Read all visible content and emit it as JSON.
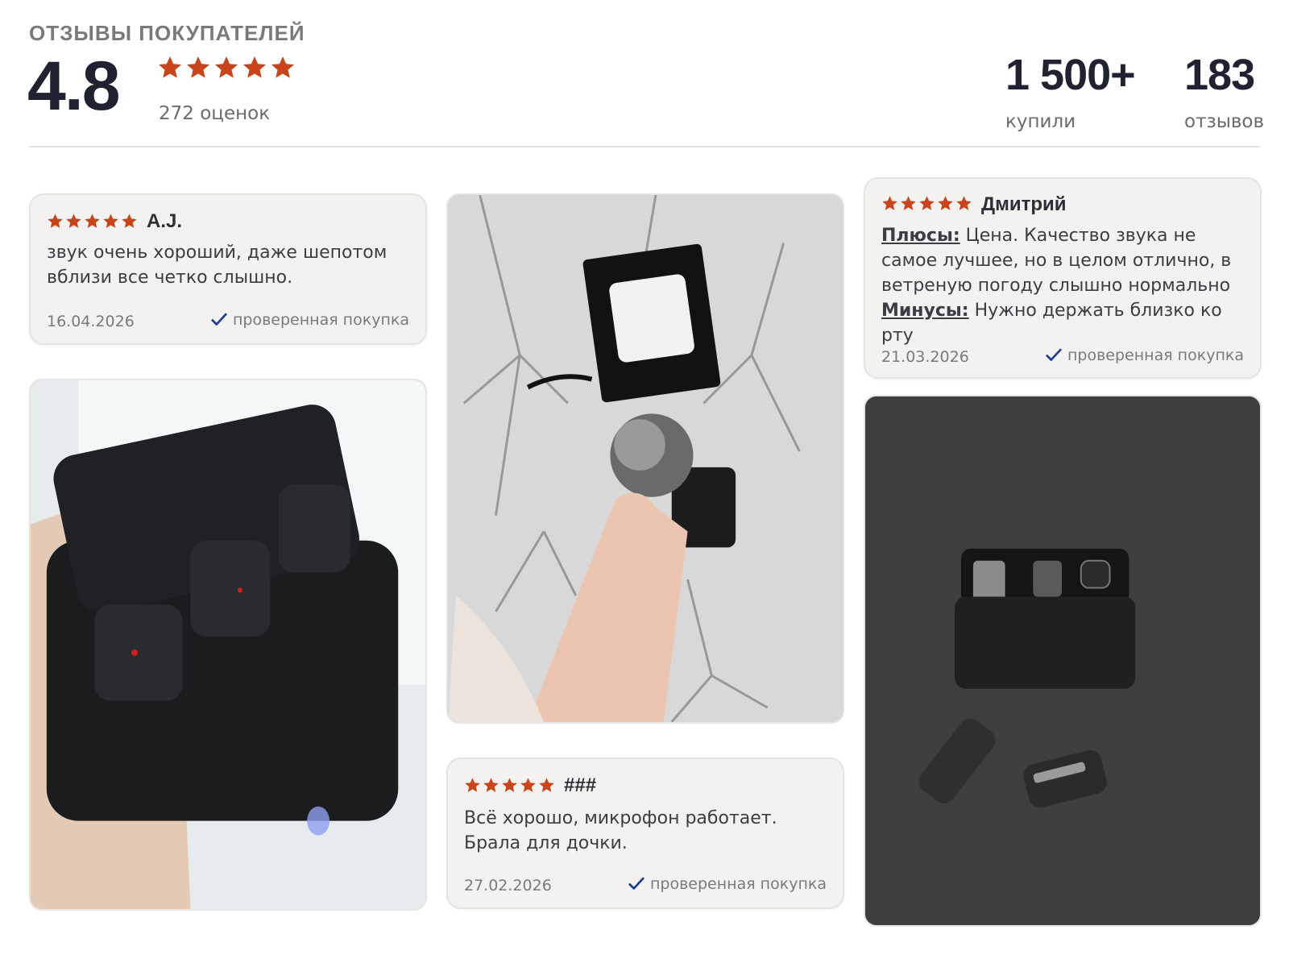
{
  "header": {
    "title": "ОТЗЫВЫ ПОКУПАТЕЛЕЙ",
    "rating": "4.8",
    "ratings_count": "272 оценок",
    "bought_value": "1 500+",
    "bought_label": "купили",
    "reviews_value": "183",
    "reviews_label": "отзывов"
  },
  "colors": {
    "star": "#c8451c",
    "check": "#1d3d8f"
  },
  "reviews": [
    {
      "author": "A.J.",
      "stars": 5,
      "text": "звук очень хороший, даже шепотом вблизи все четко слышно.",
      "date": "16.04.2026",
      "verified": "проверенная покупка"
    },
    {
      "author": "Дмитрий",
      "stars": 5,
      "pros_label": "Плюсы:",
      "pros_text": "Цена. Качество звука не самое лучшее, но в целом отлично, в ветреную погоду слышно нормально",
      "cons_label": "Минусы:",
      "cons_text": "Нужно держать близко ко рту",
      "date": "21.03.2026",
      "verified": "проверенная покупка"
    },
    {
      "author": "###",
      "stars": 5,
      "text": "Всё хорошо, микрофон работает. Брала для дочки.",
      "date": "27.02.2026",
      "verified": "проверенная покупка"
    }
  ],
  "photos": [
    {
      "depicts": "black-charging-case-with-microphones"
    },
    {
      "depicts": "hand-holding-furry-windscreen-microphone"
    },
    {
      "depicts": "charging-case-on-dark-surface"
    }
  ]
}
